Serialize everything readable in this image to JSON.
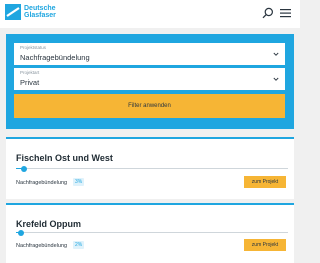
{
  "header": {
    "logo_line1": "Deutsche",
    "logo_line2": "Glasfaser"
  },
  "filters": {
    "project_status": {
      "label": "Projektstatus",
      "value": "Nachfragebündelung"
    },
    "project_type": {
      "label": "Projektart",
      "value": "Privat"
    },
    "apply_label": "Filter anwenden"
  },
  "projects": [
    {
      "title": "Fischeln Ost und West",
      "status": "Nachfragebündelung",
      "percent_label": "3%",
      "progress": 0.03,
      "button_label": "zum Projekt"
    },
    {
      "title": "Krefeld Oppum",
      "status": "Nachfragebündelung",
      "percent_label": "2%",
      "progress": 0.02,
      "button_label": "zum Projekt"
    }
  ],
  "colors": {
    "accent_blue": "#1fa6e0",
    "accent_yellow": "#f6b535",
    "background": "#f0f0f0"
  }
}
